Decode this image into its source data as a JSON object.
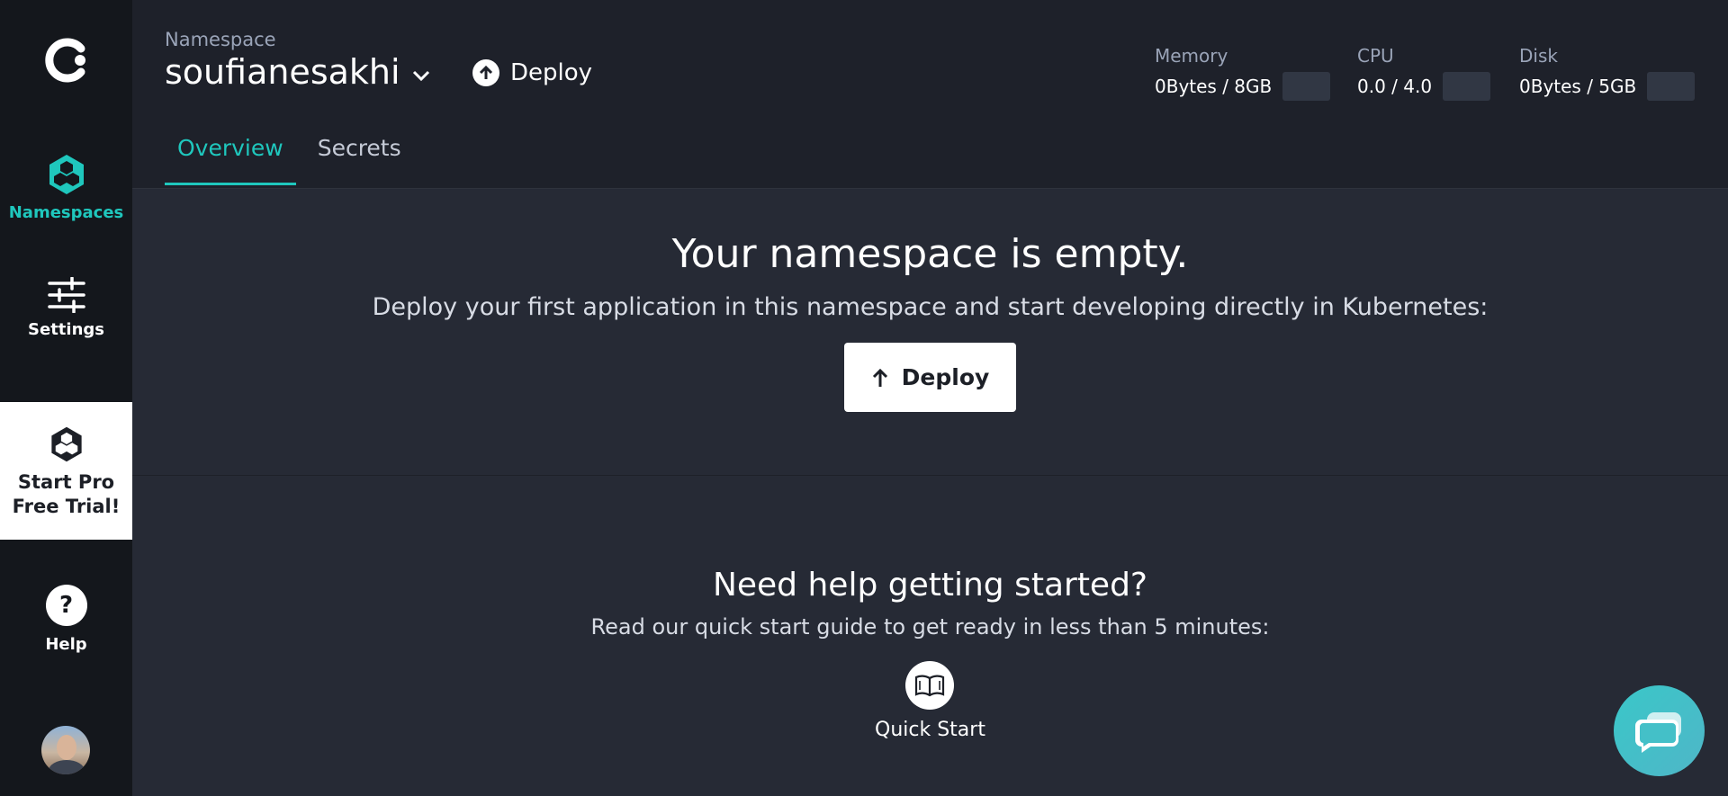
{
  "sidebar": {
    "namespaces_label": "Namespaces",
    "settings_label": "Settings",
    "trial_line1": "Start Pro",
    "trial_line2": "Free Trial!",
    "help_label": "Help",
    "help_glyph": "?"
  },
  "header": {
    "namespace_label": "Namespace",
    "namespace_name": "soufianesakhi",
    "deploy_label": "Deploy",
    "metrics": {
      "memory": {
        "label": "Memory",
        "value": "0Bytes / 8GB"
      },
      "cpu": {
        "label": "CPU",
        "value": "0.0 / 4.0"
      },
      "disk": {
        "label": "Disk",
        "value": "0Bytes / 5GB"
      }
    },
    "tabs": [
      {
        "label": "Overview",
        "active": true
      },
      {
        "label": "Secrets",
        "active": false
      }
    ]
  },
  "empty_state": {
    "title": "Your namespace is empty.",
    "description": "Deploy your first application in this namespace and start developing directly in Kubernetes:",
    "button_label": "Deploy"
  },
  "help_section": {
    "title": "Need help getting started?",
    "description": "Read our quick start guide to get ready in less than 5 minutes:",
    "quick_start_label": "Quick Start"
  },
  "colors": {
    "accent": "#1fc7bd",
    "sidebar_bg": "#14171c",
    "header_bg": "#1e212a",
    "main_bg": "#262a35",
    "chat_bg": "#3ac7c9"
  },
  "icons": [
    "logo-icon",
    "hexagon-icon",
    "sliders-icon",
    "help-icon",
    "chevron-down-icon",
    "arrow-up-icon",
    "book-icon",
    "chat-icon"
  ]
}
